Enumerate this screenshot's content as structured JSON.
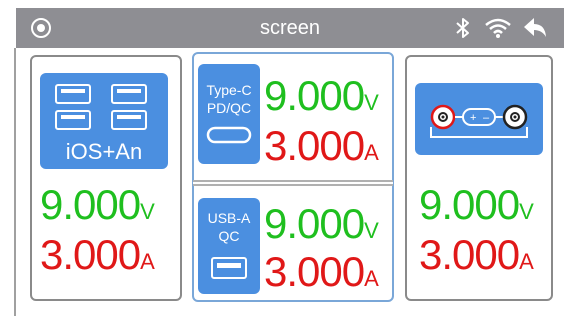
{
  "titlebar": {
    "title": "screen",
    "left_icon": "target-icon",
    "right_icons": [
      "bluetooth-icon",
      "wifi-icon",
      "back-icon"
    ]
  },
  "panels": {
    "left": {
      "label": "iOS+An",
      "icon": "usb-ports-icon",
      "voltage": "9.000",
      "voltage_unit": "V",
      "current": "3.000",
      "current_unit": "A"
    },
    "middle_top": {
      "label_line1": "Type-C",
      "label_line2": "PD/QC",
      "icon": "usb-c-port-icon",
      "voltage": "9.000",
      "voltage_unit": "V",
      "current": "3.000",
      "current_unit": "A"
    },
    "middle_bottom": {
      "label_line1": "USB-A",
      "label_line2": "QC",
      "icon": "usb-a-port-icon",
      "voltage": "9.000",
      "voltage_unit": "V",
      "current": "3.000",
      "current_unit": "A"
    },
    "right": {
      "icon": "dc-terminals-icon",
      "voltage": "9.000",
      "voltage_unit": "V",
      "current": "3.000",
      "current_unit": "A"
    }
  },
  "colors": {
    "titlebar": "#8e8e93",
    "accent_blue": "#4b8fe0",
    "voltage_green": "#1fbf1f",
    "current_red": "#e01818"
  }
}
